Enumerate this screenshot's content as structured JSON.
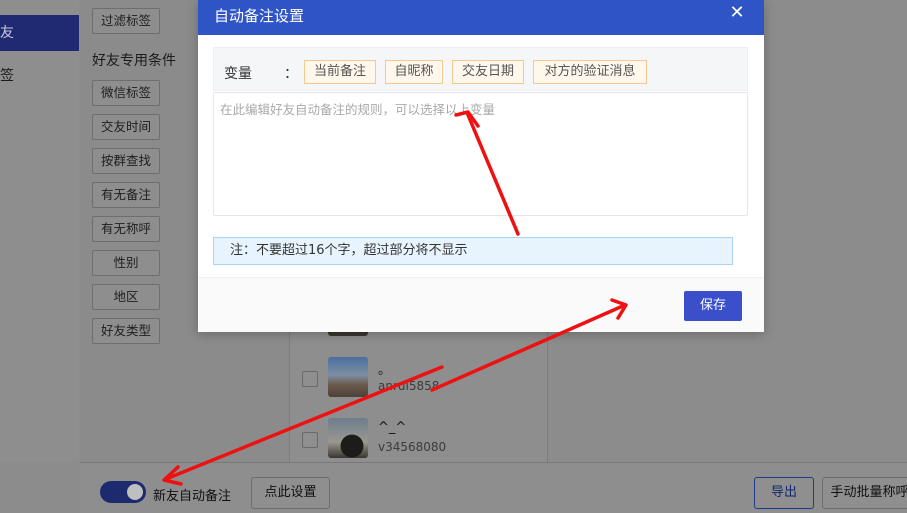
{
  "nav": {
    "items": [
      {
        "label": "友",
        "active": true
      },
      {
        "label": "签",
        "active": false
      }
    ]
  },
  "filters": {
    "top_tag": "过滤标签",
    "section_title": "好友专用条件",
    "tags": [
      "微信标签",
      "交友时间",
      "按群查找",
      "有无备注",
      "有无称呼",
      "性别",
      "地区",
      "好友类型"
    ]
  },
  "contacts": [
    {
      "name": "。",
      "id": "anrui5858"
    },
    {
      "name": "^_^",
      "id": "v34568080"
    }
  ],
  "bottom_bar": {
    "toggle_label": "新友自动备注",
    "settings_button": "点此设置",
    "export_button": "导出",
    "batch_button": "手动批量称呼"
  },
  "modal": {
    "title": "自动备注设置",
    "var_label": "变量",
    "var_colon": "：",
    "variables": [
      "当前备注",
      "自昵称",
      "交友日期",
      "对方的验证消息"
    ],
    "rule_placeholder": "在此编辑好友自动备注的规则，可以选择以上变量",
    "note": "注：不要超过16个字，超过部分将不显示",
    "save_button": "保存"
  },
  "colors": {
    "header_blue": "#2f54c5",
    "save_blue": "#3a4fc9",
    "arrow_red": "#ee1111",
    "chip_border": "#f3c894",
    "note_bg": "#e8f4fd"
  }
}
